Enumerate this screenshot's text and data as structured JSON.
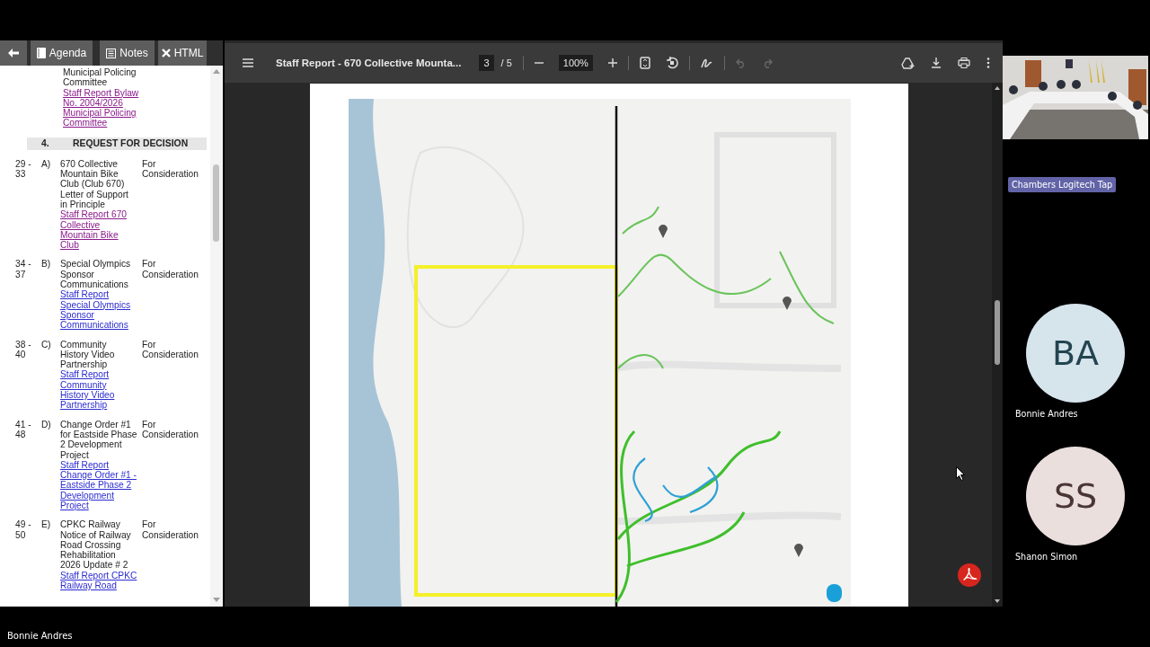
{
  "agenda_panel": {
    "toolbar": [
      {
        "kind": "back"
      },
      {
        "kind": "agenda",
        "label": "Agenda"
      },
      {
        "kind": "notes",
        "label": "Notes"
      },
      {
        "kind": "close",
        "label": "HTML"
      }
    ],
    "continued": {
      "title": "Municipal Policing Committee",
      "link": "Staff Report Bylaw No. 2004/2026 Municipal Policing Committee",
      "visited": true
    },
    "section": {
      "number": "4.",
      "title": "REQUEST FOR DECISION"
    },
    "items": [
      {
        "pages": "29 - 33",
        "letter": "A)",
        "title": "670 Collective Mountain Bike Club (Club 670) Letter of Support in Principle",
        "link": "Staff Report 670 Collective Mountain Bike Club",
        "visited": true,
        "status": "For Consideration"
      },
      {
        "pages": "34 - 37",
        "letter": "B)",
        "title": "Special Olympics Sponsor Communications",
        "link": "Staff Report Special Olympics Sponsor Communications",
        "visited": false,
        "status": "For Consideration"
      },
      {
        "pages": "38 - 40",
        "letter": "C)",
        "title": "Community History Video Partnership",
        "link": "Staff Report Community History Video Partnership",
        "visited": false,
        "status": "For Consideration"
      },
      {
        "pages": "41 - 48",
        "letter": "D)",
        "title": "Change Order #1 for Eastside Phase 2 Development Project",
        "link": "Staff Report Change Order #1 - Eastside Phase 2 Development Project",
        "visited": false,
        "status": "For Consideration"
      },
      {
        "pages": "49 - 50",
        "letter": "E)",
        "title": "CPKC Railway Notice of Railway Road Crossing Rehabilitation 2026 Update # 2",
        "link": "Staff Report CPKC Railway Road",
        "visited": false,
        "status": "For Consideration"
      }
    ]
  },
  "pdf_viewer": {
    "title": "Staff Report - 670 Collective Mounta...",
    "page": "3",
    "page_total": "/ 5",
    "zoom": "100%",
    "tools": [
      {
        "kind": "fit",
        "disabled": false
      },
      {
        "kind": "rotate",
        "disabled": false
      },
      {
        "kind": "draw",
        "disabled": false
      },
      {
        "kind": "undo",
        "disabled": true
      },
      {
        "kind": "redo",
        "disabled": true
      }
    ]
  },
  "meeting": {
    "room_label": "Chambers Logitech Tap",
    "participants": [
      {
        "initials": "BA",
        "name": "Bonnie Andres",
        "color": "#d6e4ec"
      },
      {
        "initials": "SS",
        "name": "Shanon Simon",
        "color": "#eadfdc"
      }
    ],
    "speaker": "Bonnie Andres"
  }
}
